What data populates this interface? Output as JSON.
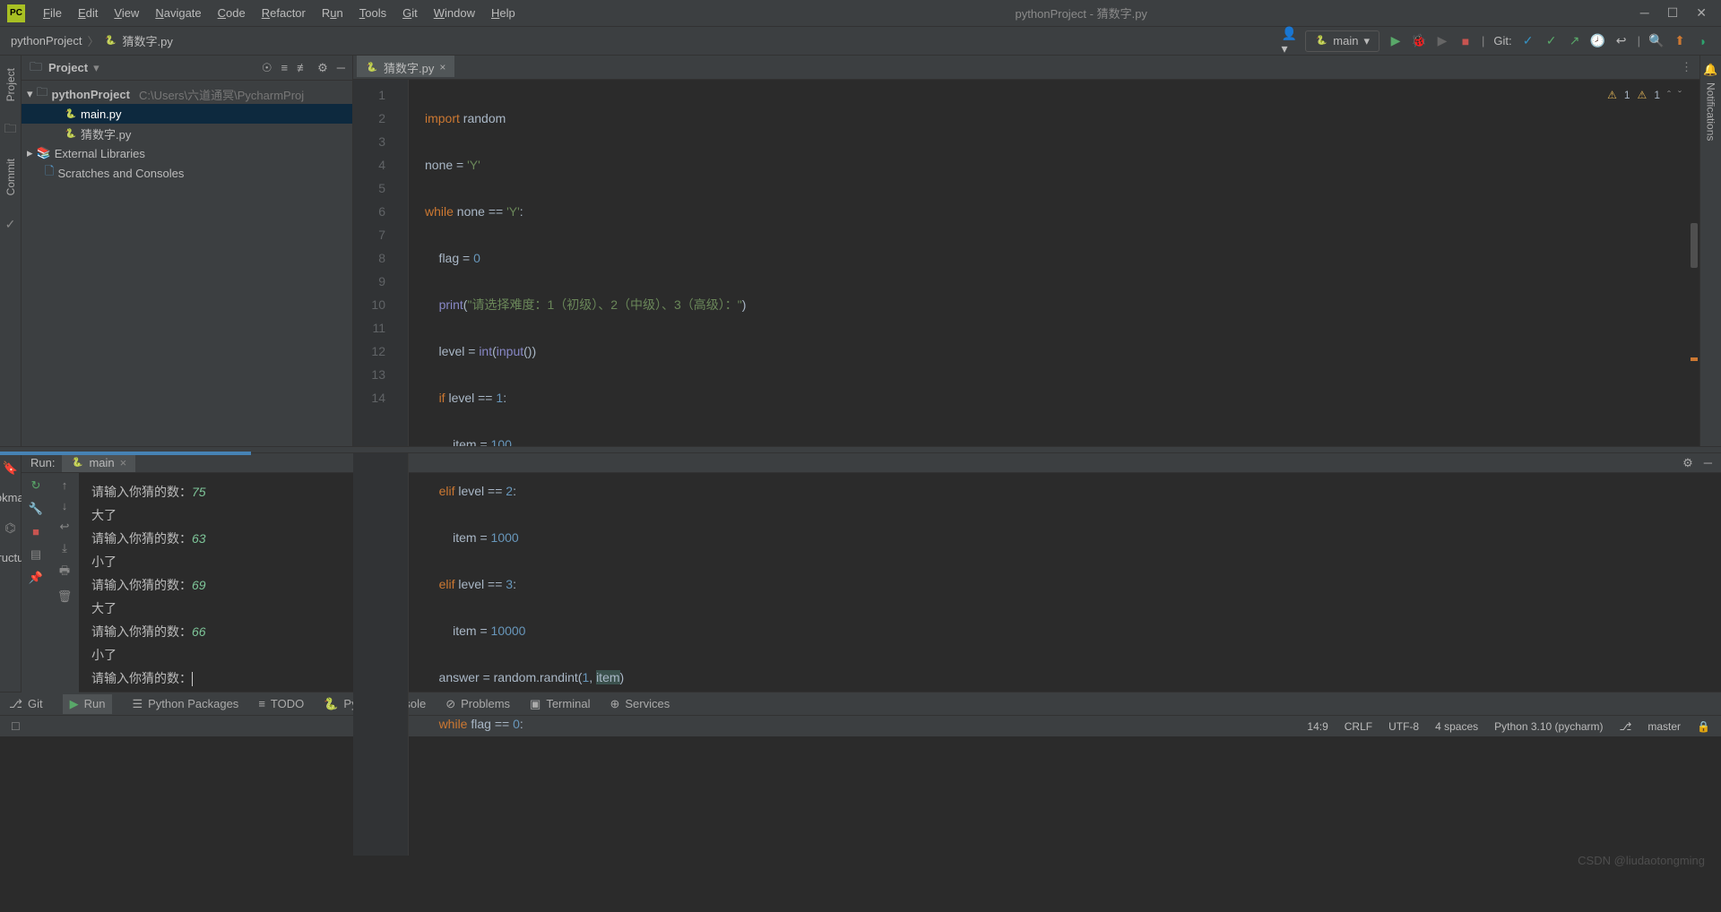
{
  "window": {
    "title": "pythonProject - 猜数字.py",
    "menu": [
      "File",
      "Edit",
      "View",
      "Navigate",
      "Code",
      "Refactor",
      "Run",
      "Tools",
      "Git",
      "Window",
      "Help"
    ]
  },
  "breadcrumb": {
    "project": "pythonProject",
    "file": "猜数字.py"
  },
  "run_config": {
    "label": "main"
  },
  "git_label": "Git:",
  "project_panel": {
    "title": "Project",
    "root": "pythonProject",
    "root_path": "C:\\Users\\六道通冥\\PycharmProj",
    "files": [
      "main.py",
      "猜数字.py"
    ],
    "external": "External Libraries",
    "scratches": "Scratches and Consoles"
  },
  "editor": {
    "tab": "猜数字.py",
    "warnings": {
      "a1": "1",
      "a2": "1"
    },
    "lines": [
      "1",
      "2",
      "3",
      "4",
      "5",
      "6",
      "7",
      "8",
      "9",
      "10",
      "11",
      "12",
      "13",
      "14"
    ],
    "code": {
      "l1_import": "import",
      "l1_mod": " random",
      "l2a": "none = ",
      "l2b": "'Y'",
      "l3a": "while",
      "l3b": " none == ",
      "l3c": "'Y'",
      "l3d": ":",
      "l4a": "    flag = ",
      "l4b": "0",
      "l5a": "    ",
      "l5p": "print",
      "l5b": "(",
      "l5c": "\"请选择难度：1（初级）、2（中级）、3（高级）：\"",
      "l5d": ")",
      "l6a": "    level = ",
      "l6b": "int",
      "l6c": "(",
      "l6d": "input",
      "l6e": "())",
      "l7a": "    ",
      "l7if": "if",
      "l7b": " level == ",
      "l7c": "1",
      "l7d": ":",
      "l8a": "        item = ",
      "l8b": "100",
      "l9a": "    ",
      "l9e": "elif",
      "l9b": " level == ",
      "l9c": "2",
      "l9d": ":",
      "l10a": "        item = ",
      "l10b": "1000",
      "l11a": "    ",
      "l11e": "elif",
      "l11b": " level == ",
      "l11c": "3",
      "l11d": ":",
      "l12a": "        item = ",
      "l12b": "10000",
      "l13a": "    answer = random.randint(",
      "l13b": "1",
      "l13c": ", ",
      "l13d": "item",
      "l13e": ")",
      "l14a": "    ",
      "l14w": "while",
      "l14b": " flag == ",
      "l14c": "0",
      "l14d": ":"
    }
  },
  "run_panel": {
    "label": "Run:",
    "tab": "main",
    "output": [
      {
        "prompt": "请输入你猜的数：",
        "val": "75"
      },
      {
        "text": "大了"
      },
      {
        "prompt": "请输入你猜的数：",
        "val": "63"
      },
      {
        "text": "小了"
      },
      {
        "prompt": "请输入你猜的数：",
        "val": "69"
      },
      {
        "text": "大了"
      },
      {
        "prompt": "请输入你猜的数：",
        "val": "66"
      },
      {
        "text": "小了"
      },
      {
        "prompt": "请输入你猜的数：",
        "val": ""
      }
    ]
  },
  "toolwin": [
    "Git",
    "Run",
    "Python Packages",
    "TODO",
    "Python Console",
    "Problems",
    "Terminal",
    "Services"
  ],
  "statusbar": {
    "pos": "14:9",
    "crlf": "CRLF",
    "enc": "UTF-8",
    "indent": "4 spaces",
    "python": "Python 3.10 (pycharm)",
    "branch": "master"
  },
  "side_left": [
    "Project",
    "Commit",
    "Bookmarks",
    "Structure"
  ],
  "side_right": "Notifications",
  "watermark": "CSDN @liudaotongming"
}
